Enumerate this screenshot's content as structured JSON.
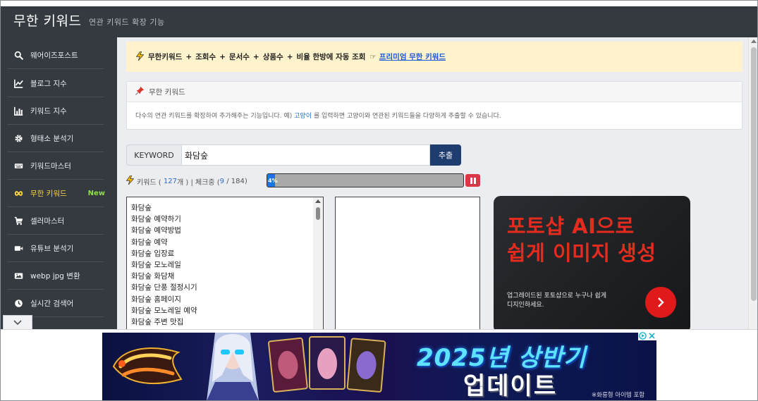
{
  "header": {
    "title": "무한 키워드",
    "subtitle": "연관 키워드 확장 기능"
  },
  "sidebar": {
    "items": [
      {
        "label": "웨어이즈포스트",
        "icon": "search-icon"
      },
      {
        "label": "블로그 지수",
        "icon": "line-chart-icon"
      },
      {
        "label": "키워드 지수",
        "icon": "bar-chart-icon"
      },
      {
        "label": "형태소 분석기",
        "icon": "gear-icon"
      },
      {
        "label": "키워드마스터",
        "icon": "keyboard-icon"
      },
      {
        "label": "무한 키워드",
        "icon": "infinity-icon",
        "badge": "New",
        "active": true
      },
      {
        "label": "셀러마스터",
        "icon": "cart-icon"
      },
      {
        "label": "유튜브 분석기",
        "icon": "video-camera-icon"
      },
      {
        "label": "webp jpg 변환",
        "icon": "image-icon"
      },
      {
        "label": "실시간 검색어",
        "icon": "clock-icon"
      }
    ]
  },
  "notice": {
    "parts": [
      "무한키워드",
      "+",
      "조회수",
      "+",
      "문서수",
      "+",
      "상품수",
      "+",
      "비율 한방에 자동 조회"
    ],
    "hand": "☞",
    "link": "프리미엄 무한 키워드"
  },
  "card": {
    "title": "무한 키워드",
    "desc_before": "다수의 연관 키워드를 확장하여 추가해주는 기능입니다. 예)",
    "desc_highlight": "고양이",
    "desc_after": "를 입력하면 고양이와 연관된 키워드들을 다양하게 추출할 수 있습니다."
  },
  "search": {
    "label": "KEYWORD",
    "value": "화담숲",
    "button": "추출"
  },
  "stats": {
    "prefix": "키워드 (",
    "count": "127",
    "unit": "개 )",
    "sep": "| 체크중 (",
    "checked": "9",
    "slash": "/",
    "total": "184",
    "suffix": ")",
    "progress_percent": 4,
    "progress_label": "4%"
  },
  "keywords": [
    "화담숲",
    "화담숲 예약하기",
    "화담숲 예약방법",
    "화담숲 예약",
    "화담숲 입장료",
    "화담숲 모노레일",
    "화담숲 화담채",
    "화담숲 단풍 절정시기",
    "화담숲 홈페이지",
    "화담숲 모노레일 예약",
    "화담숲 주변 맛집"
  ],
  "ad": {
    "headline_1": "포토샵 AI으로",
    "headline_2": "쉽게 이미지 생성",
    "sub_1": "업그레이드된 포토샵으로 누구나 쉽게",
    "sub_2": "디지인하세요."
  },
  "banner": {
    "line1": "2025년 상반기",
    "line2": "업데이트",
    "note": "※화릉형 아이템 포함"
  },
  "colors": {
    "header_bg": "#343a40",
    "accent": "#1f3c6e",
    "notice_bg": "#fff3cd",
    "active": "#ffd43b",
    "new_badge": "#8ee04a",
    "danger": "#dc3545",
    "ad_red": "#e52a1e"
  }
}
